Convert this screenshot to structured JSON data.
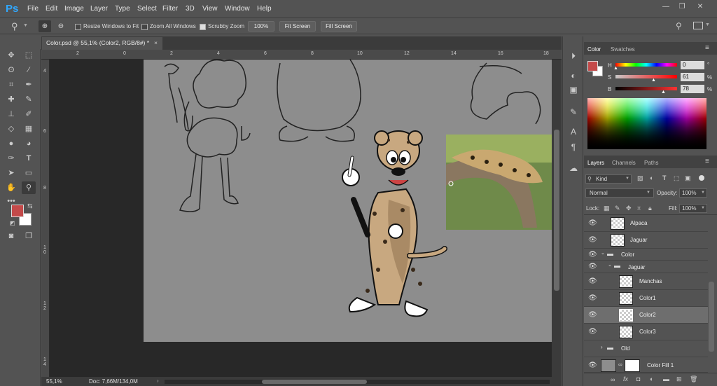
{
  "app": {
    "logo": "Ps"
  },
  "menu": [
    "File",
    "Edit",
    "Image",
    "Layer",
    "Type",
    "Select",
    "Filter",
    "3D",
    "View",
    "Window",
    "Help"
  ],
  "options": {
    "resize_windows": "Resize Windows to Fit",
    "zoom_all": "Zoom All Windows",
    "scrubby": "Scrubby Zoom",
    "zoom_value": "100%",
    "fit_screen": "Fit Screen",
    "fill_screen": "Fill Screen"
  },
  "document": {
    "tab_title": "Color.psd @ 55,1% (Color2, RGB/8#) *",
    "zoom": "55,1%",
    "doc_info": "Doc: 7,66M/134,0M"
  },
  "rulers": {
    "h": [
      "2",
      "0",
      "2",
      "4",
      "6",
      "8",
      "10",
      "12",
      "14",
      "16",
      "18"
    ],
    "v": [
      "4",
      "6",
      "8",
      "1 0",
      "1 2",
      "1 4"
    ]
  },
  "color_panel": {
    "tabs": [
      "Color",
      "Swatches"
    ],
    "sliders": [
      {
        "label": "H",
        "value": "0",
        "unit": "°",
        "pos": 0
      },
      {
        "label": "S",
        "value": "61",
        "unit": "%",
        "pos": 61
      },
      {
        "label": "B",
        "value": "78",
        "unit": "%",
        "pos": 78
      }
    ],
    "foreground": "#c44a4a",
    "background": "#ffffff"
  },
  "layers_panel": {
    "tabs": [
      "Layers",
      "Channels",
      "Paths"
    ],
    "filter": "Kind",
    "blend_mode": "Normal",
    "opacity_label": "Opacity:",
    "opacity": "100%",
    "lock_label": "Lock:",
    "fill_label": "Fill:",
    "fill": "100%",
    "layers": [
      {
        "name": "Alpaca",
        "indent": 1,
        "type": "smart",
        "selected": false
      },
      {
        "name": "Jaguar",
        "indent": 1,
        "type": "smart",
        "selected": false
      },
      {
        "name": "Color",
        "indent": 0,
        "type": "group-open",
        "selected": false
      },
      {
        "name": "Jaguar",
        "indent": 1,
        "type": "group-open",
        "selected": false
      },
      {
        "name": "Manchas",
        "indent": 2,
        "type": "layer",
        "selected": false
      },
      {
        "name": "Color1",
        "indent": 2,
        "type": "layer",
        "selected": false
      },
      {
        "name": "Color2",
        "indent": 2,
        "type": "layer",
        "selected": true
      },
      {
        "name": "Color3",
        "indent": 2,
        "type": "layer",
        "selected": false
      },
      {
        "name": "Old",
        "indent": 0,
        "type": "group-closed",
        "selected": false
      },
      {
        "name": "Color Fill 1",
        "indent": 0,
        "type": "fill",
        "selected": false
      }
    ]
  }
}
